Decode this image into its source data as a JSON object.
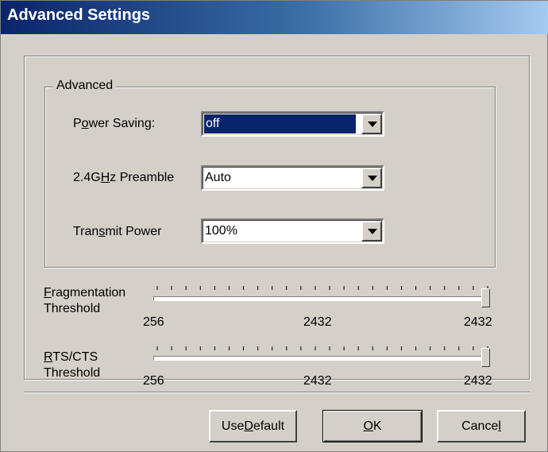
{
  "window": {
    "title": "Advanced Settings"
  },
  "group": {
    "title": "Advanced"
  },
  "power_saving": {
    "label_pre": "P",
    "label_key": "o",
    "label_post": "wer Saving:",
    "value": "off"
  },
  "preamble": {
    "label_pre": "2.4G",
    "label_key": "H",
    "label_post": "z Preamble",
    "value": "Auto"
  },
  "transmit_power": {
    "label_pre": "Tran",
    "label_key": "s",
    "label_post": "mit Power",
    "value": "100%"
  },
  "fragmentation": {
    "label_key": "F",
    "label_line1_post": "ragmentation",
    "label_line2": "Threshold",
    "min_label": "256",
    "current_label": "2432",
    "max_label": "2432",
    "min": 256,
    "max": 2432,
    "value": 2432
  },
  "rts": {
    "label_key": "R",
    "label_line1_post": "TS/CTS",
    "label_line2": "Threshold",
    "min_label": "256",
    "current_label": "2432",
    "max_label": "2432",
    "min": 256,
    "max": 2432,
    "value": 2432
  },
  "buttons": {
    "use_default_pre": "Use ",
    "use_default_key": "D",
    "use_default_post": "efault",
    "ok_key": "O",
    "ok_post": "K",
    "cancel_pre": "Cance",
    "cancel_key": "l"
  },
  "colors": {
    "title_start": "#0a246a",
    "title_end": "#a6caf0",
    "face": "#d4d0c8",
    "selection": "#0a246a"
  },
  "icons": {
    "combo_arrow": "chevron-down-icon"
  }
}
